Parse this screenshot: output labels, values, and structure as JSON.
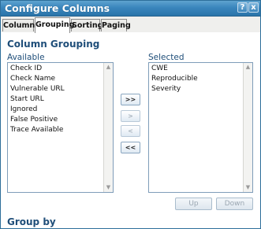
{
  "window": {
    "title": "Configure Columns",
    "help_label": "?",
    "close_label": "x"
  },
  "tabs": [
    {
      "label": "Columns",
      "active": false
    },
    {
      "label": "Grouping",
      "active": true
    },
    {
      "label": "Sorting",
      "active": false
    },
    {
      "label": "Paging",
      "active": false
    }
  ],
  "grouping": {
    "heading": "Column Grouping",
    "available_label": "Available",
    "selected_label": "Selected",
    "available_items": [
      "Check ID",
      "Check Name",
      "Vulnerable URL",
      "Start URL",
      "Ignored",
      "False Positive",
      "Trace Available"
    ],
    "selected_items": [
      "CWE",
      "Reproducible",
      "Severity"
    ],
    "buttons": {
      "add_all": ">>",
      "add": ">",
      "remove": "<",
      "remove_all": "<<"
    },
    "up_label": "Up",
    "down_label": "Down"
  },
  "group_by": {
    "heading": "Group by"
  },
  "icons": {
    "scroll_up": "▲",
    "scroll_down": "▼"
  }
}
